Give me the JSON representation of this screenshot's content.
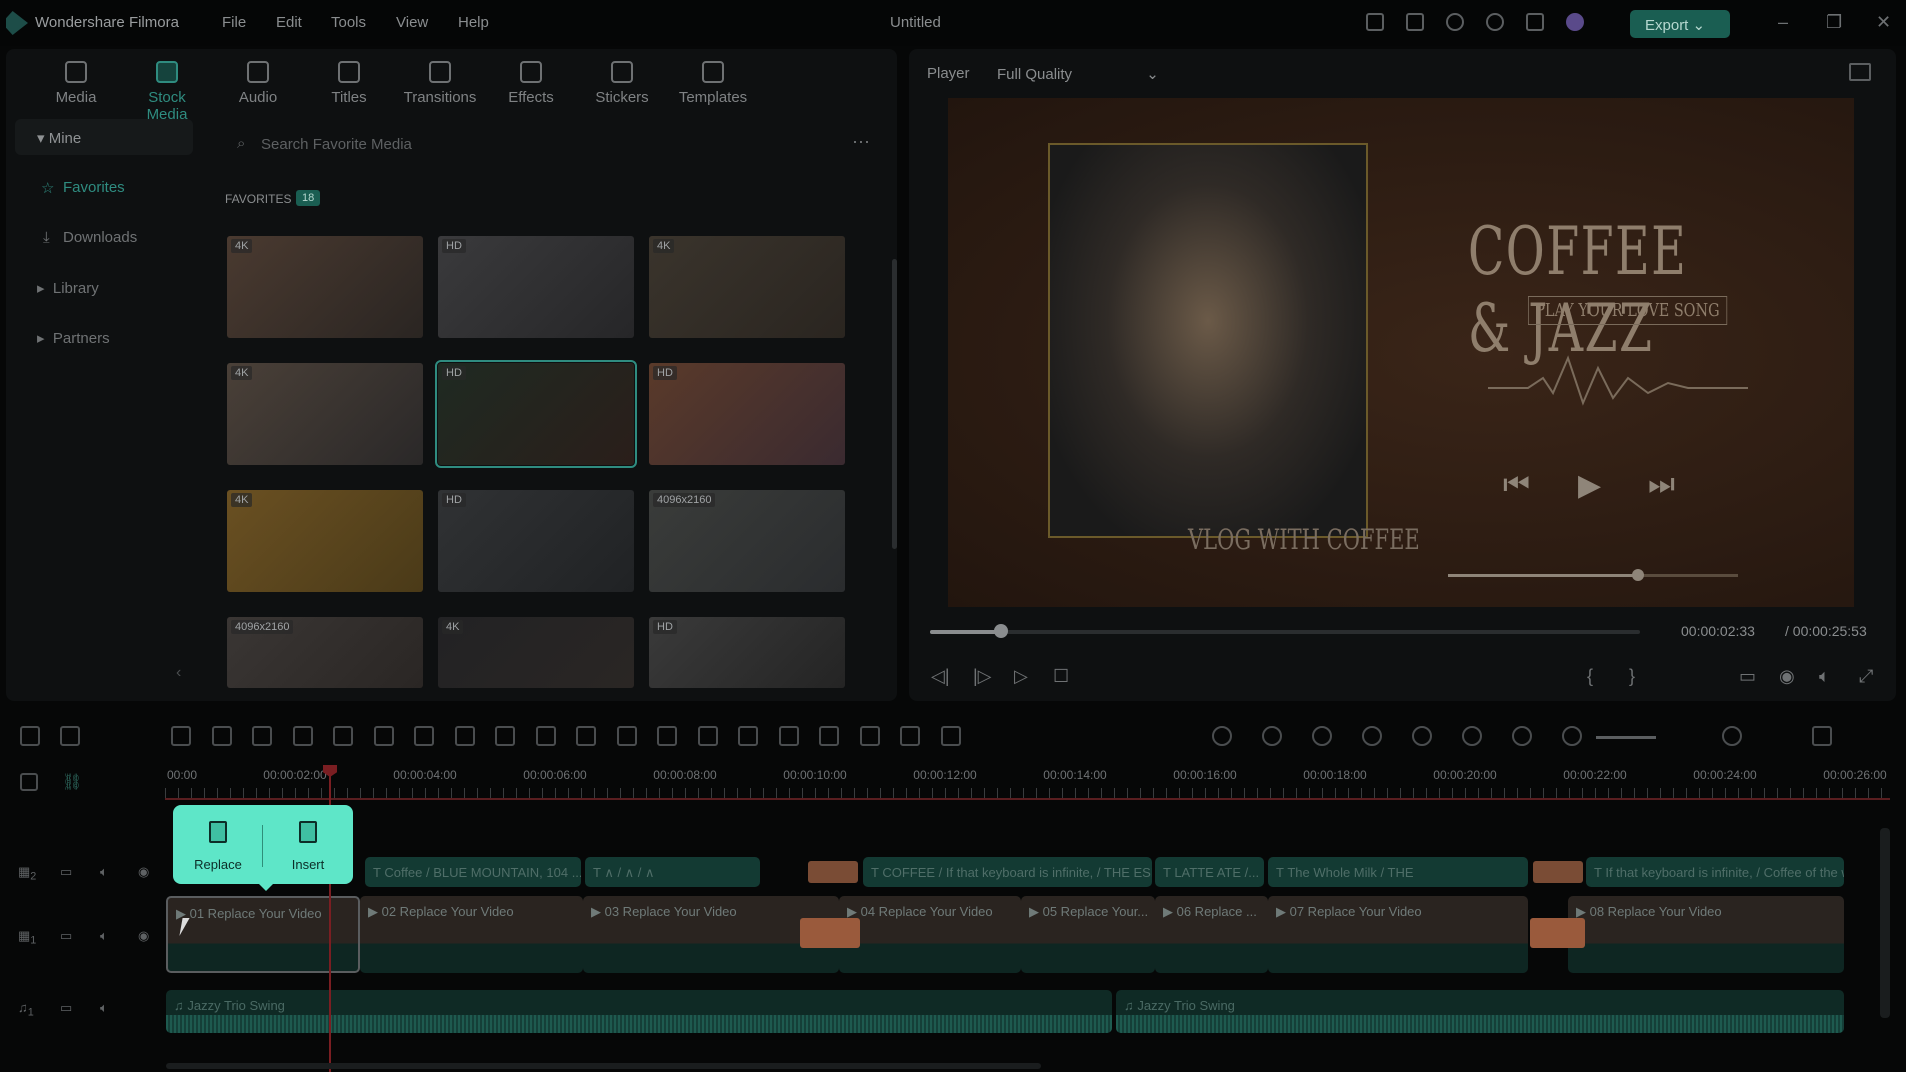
{
  "app": {
    "name": "Wondershare Filmora",
    "project_title": "Untitled",
    "menu": [
      "File",
      "Edit",
      "Tools",
      "View",
      "Help"
    ],
    "export_label": "Export",
    "accent": "#1a5e52"
  },
  "tabs": [
    {
      "label": "Media",
      "icon": "media-icon"
    },
    {
      "label": "Stock Media",
      "icon": "stock-media-icon",
      "active": true
    },
    {
      "label": "Audio",
      "icon": "music-note-icon"
    },
    {
      "label": "Titles",
      "icon": "text-icon"
    },
    {
      "label": "Transitions",
      "icon": "transitions-icon"
    },
    {
      "label": "Effects",
      "icon": "effects-icon"
    },
    {
      "label": "Stickers",
      "icon": "stickers-icon"
    },
    {
      "label": "Templates",
      "icon": "templates-icon"
    }
  ],
  "sidebar": {
    "mine": "Mine",
    "favorites": "Favorites",
    "downloads": "Downloads",
    "library": "Library",
    "partners": "Partners"
  },
  "search": {
    "placeholder": "Search Favorite Media"
  },
  "favorites": {
    "label": "FAVORITES",
    "count": "18",
    "items": [
      "4K",
      "HD",
      "4K",
      "4K",
      "HD",
      "HD",
      "4K",
      "HD",
      "4096x2160",
      "4096x2160",
      "4K",
      "HD"
    ],
    "selected_index": 4
  },
  "player": {
    "label": "Player",
    "quality": "Full Quality",
    "current_time": "00:00:02:33",
    "total_time": "/ 00:00:25:53",
    "progress_percent": 10,
    "preview": {
      "title": "COFFEE & JAZZ",
      "subtitle": "PLAY YOUR LOVE SONG",
      "caption": "VLOG WITH COFFEE"
    }
  },
  "timeline": {
    "ruler": [
      "00:00",
      "00:00:02:00",
      "00:00:04:00",
      "00:00:06:00",
      "00:00:08:00",
      "00:00:10:00",
      "00:00:12:00",
      "00:00:14:00",
      "00:00:16:00",
      "00:00:18:00",
      "00:00:20:00",
      "00:00:22:00",
      "00:00:24:00",
      "00:00:26:00"
    ],
    "tracks": {
      "title": "2",
      "video": "1",
      "audio": "1"
    },
    "title_clips": [
      "Coffee / BLUE MOUNTAIN, 104 ...",
      "∧ / ∧ / ∧",
      "COFFEE / If that keyboard is infinite, / THE ESPRES...",
      "LATTE ATE /...",
      "The Whole Milk / THE",
      "If that keyboard is infinite, / Coffee of the w..."
    ],
    "video_clips": [
      "01 Replace Your Video",
      "02 Replace Your Video",
      "03 Replace Your Video",
      "04 Replace Your Video",
      "05 Replace Your...",
      "06 Replace ...",
      "07 Replace Your Video",
      "08 Replace Your Video"
    ],
    "audio_clips": [
      "Jazzy Trio Swing",
      "Jazzy Trio Swing"
    ],
    "popup": {
      "replace": "Replace",
      "insert": "Insert"
    }
  }
}
